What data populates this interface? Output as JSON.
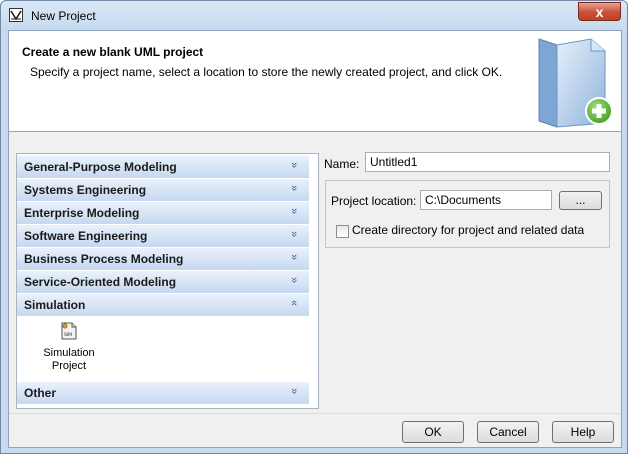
{
  "window": {
    "title": "New Project",
    "close_label": "x"
  },
  "header": {
    "title": "Create a new blank UML project",
    "description": "Specify a project name, select a location to store the newly created project, and click OK."
  },
  "categories": [
    {
      "label": "General-Purpose Modeling",
      "expanded": false
    },
    {
      "label": "Systems Engineering",
      "expanded": false
    },
    {
      "label": "Enterprise Modeling",
      "expanded": false
    },
    {
      "label": "Software Engineering",
      "expanded": false
    },
    {
      "label": "Business Process Modeling",
      "expanded": false
    },
    {
      "label": "Service-Oriented Modeling",
      "expanded": false
    },
    {
      "label": "Simulation",
      "expanded": true
    },
    {
      "label": "Other",
      "expanded": false
    }
  ],
  "chevron_collapsed": "»",
  "chevron_expanded": "«",
  "simulation_project": {
    "line1": "Simulation",
    "line2": "Project",
    "icon_text": "SIM"
  },
  "form": {
    "name_label": "Name:",
    "name_value": "Untitled1",
    "location_label": "Project location:",
    "location_value": "C:\\Documents",
    "browse_label": "...",
    "create_dir_label": "Create directory for project and related data",
    "create_dir_checked": false
  },
  "buttons": {
    "ok": "OK",
    "cancel": "Cancel",
    "help": "Help"
  },
  "colors": {
    "category_text": "#1a1a1a",
    "accent": "#3c5f8c",
    "plus": "#4caf2a"
  }
}
